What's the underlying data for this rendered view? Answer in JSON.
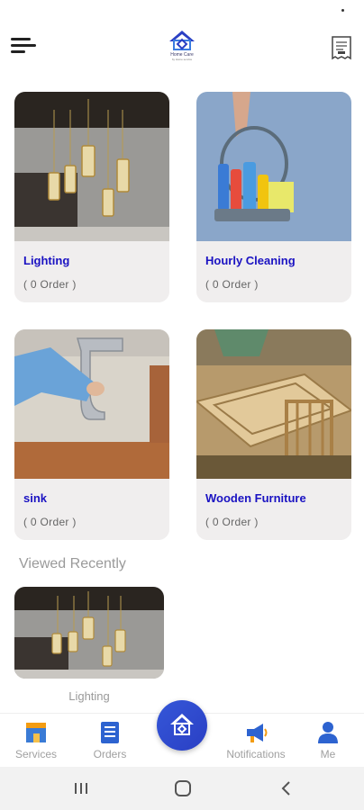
{
  "header": {
    "logo_title": "Home Care",
    "logo_subtitle": "by Home service"
  },
  "categories": [
    {
      "label": "Lighting",
      "orders": "( 0 Order )"
    },
    {
      "label": "Hourly Cleaning",
      "orders": "( 0 Order )"
    },
    {
      "label": "sink",
      "orders": "( 0 Order )"
    },
    {
      "label": "Wooden Furniture",
      "orders": "( 0 Order )"
    }
  ],
  "viewed_recently": {
    "title": "Viewed Recently",
    "items": [
      {
        "label": "Lighting"
      }
    ]
  },
  "bottom_nav": {
    "items": [
      {
        "label": "Services",
        "icon": "shop-icon"
      },
      {
        "label": "Orders",
        "icon": "list-icon"
      },
      {
        "label": "Notifications",
        "icon": "megaphone-icon"
      },
      {
        "label": "Me",
        "icon": "person-icon"
      }
    ],
    "center_icon": "home-care-logo-icon"
  },
  "colors": {
    "accent": "#1a12c2",
    "fab": "#2f4acf",
    "card_bg": "#f0eeee",
    "muted_text": "#9a9a9a"
  }
}
